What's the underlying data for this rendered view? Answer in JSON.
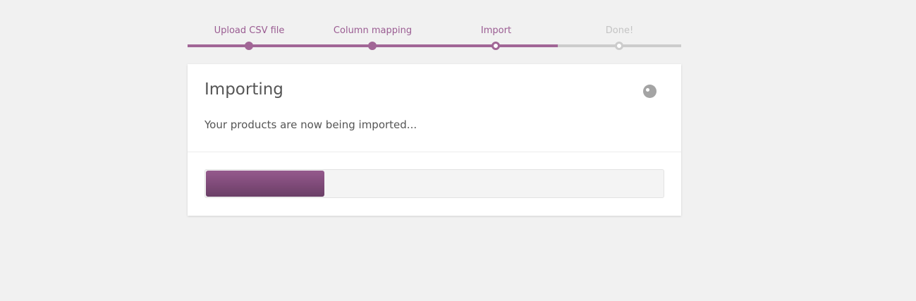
{
  "steps": [
    {
      "label": "Upload CSV file",
      "state": "done"
    },
    {
      "label": "Column mapping",
      "state": "done"
    },
    {
      "label": "Import",
      "state": "active"
    },
    {
      "label": "Done!",
      "state": "todo"
    }
  ],
  "card": {
    "title": "Importing",
    "description": "Your products are now being imported..."
  },
  "progress": {
    "value": 0.26
  },
  "colors": {
    "accent": "#a16696",
    "inactive": "#cccccc",
    "background": "#f1f1f1"
  }
}
